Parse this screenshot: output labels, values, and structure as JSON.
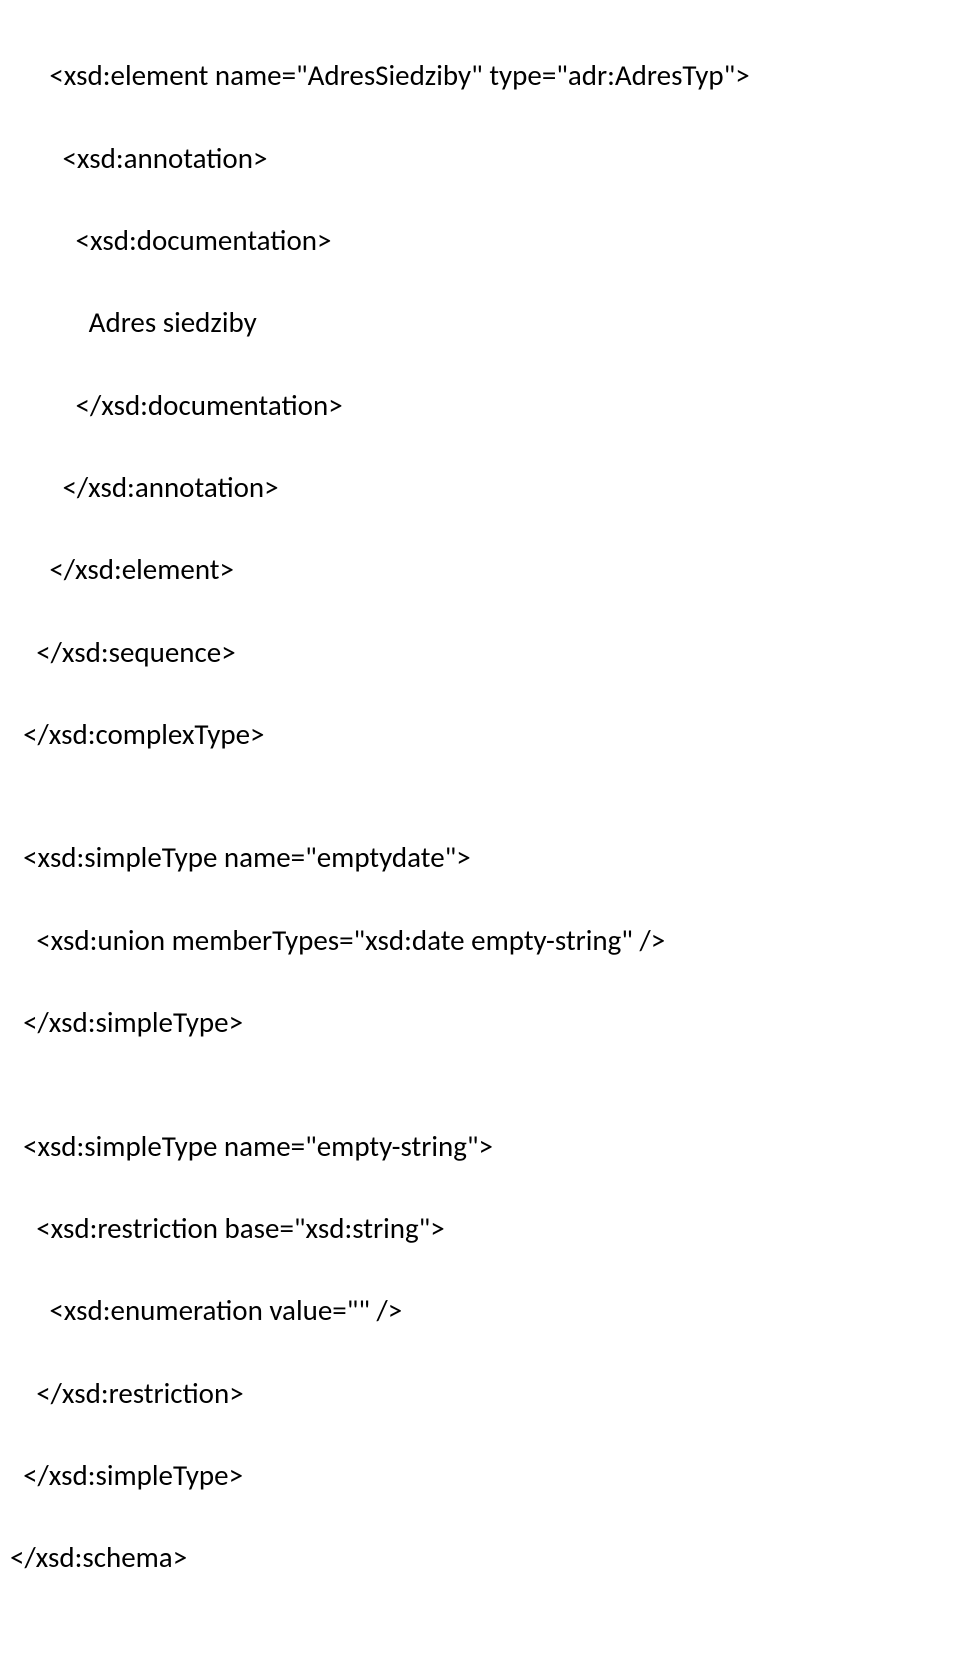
{
  "lines": [
    "      <xsd:element name=\"AdresSiedziby\" type=\"adr:AdresTyp\">",
    "        <xsd:annotation>",
    "          <xsd:documentation>",
    "            Adres siedziby",
    "          </xsd:documentation>",
    "        </xsd:annotation>",
    "      </xsd:element>",
    "    </xsd:sequence>",
    "  </xsd:complexType>",
    "",
    "  <xsd:simpleType name=\"emptydate\">",
    "    <xsd:union memberTypes=\"xsd:date empty-string\" />",
    "  </xsd:simpleType>",
    "",
    "  <xsd:simpleType name=\"empty-string\">",
    "    <xsd:restriction base=\"xsd:string\">",
    "      <xsd:enumeration value=\"\" />",
    "    </xsd:restriction>",
    "  </xsd:simpleType>",
    "</xsd:schema>"
  ]
}
